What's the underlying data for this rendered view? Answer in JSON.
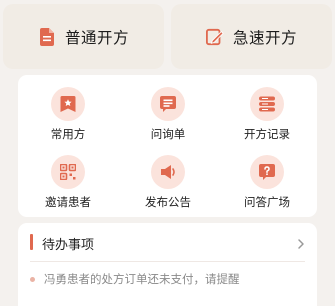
{
  "prescribe": {
    "normal_label": "普通开方",
    "urgent_label": "急速开方",
    "normal_icon": "document-icon",
    "urgent_icon": "pen-edit-icon"
  },
  "tools": {
    "items": [
      {
        "label": "常用方",
        "icon": "star-badge-icon"
      },
      {
        "label": "问询单",
        "icon": "list-form-icon"
      },
      {
        "label": "开方记录",
        "icon": "stack-records-icon"
      },
      {
        "label": "邀请患者",
        "icon": "qr-code-icon"
      },
      {
        "label": "发布公告",
        "icon": "speaker-icon"
      },
      {
        "label": "问答广场",
        "icon": "question-bubble-icon"
      }
    ]
  },
  "todo": {
    "title": "待办事项",
    "items": [
      {
        "text": "冯勇患者的处方订单还未支付，请提醒"
      }
    ]
  },
  "colors": {
    "accent": "#e0694f",
    "icon_bg": "#fbe3dc",
    "page_bg": "#f4f1ee",
    "button_bg": "#f1ece5"
  }
}
